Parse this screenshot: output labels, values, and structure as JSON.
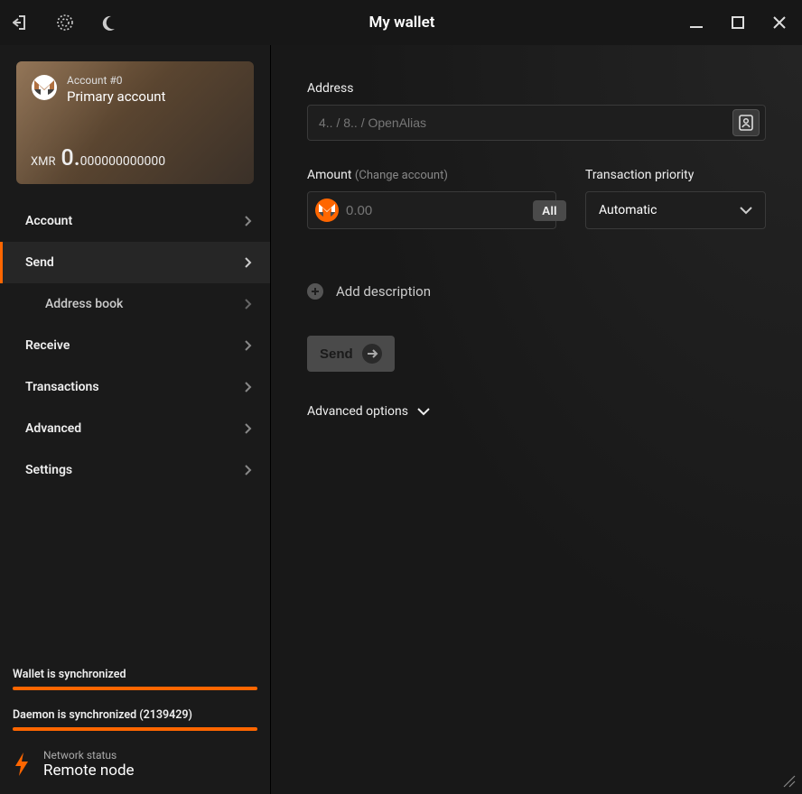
{
  "titlebar": {
    "title": "My wallet"
  },
  "account_card": {
    "account_number": "Account #0",
    "account_name": "Primary account",
    "currency": "XMR",
    "balance_int": "0.",
    "balance_frac": "000000000000"
  },
  "nav": {
    "account": "Account",
    "send": "Send",
    "address_book": "Address book",
    "receive": "Receive",
    "transactions": "Transactions",
    "advanced": "Advanced",
    "settings": "Settings"
  },
  "sync": {
    "wallet": "Wallet is synchronized",
    "daemon": "Daemon is synchronized (2139429)"
  },
  "network": {
    "label": "Network status",
    "value": "Remote node"
  },
  "send_form": {
    "address_label": "Address",
    "address_placeholder": "4.. / 8.. / OpenAlias",
    "amount_label": "Amount",
    "amount_hint": "(Change account)",
    "amount_placeholder": "0.00",
    "all_label": "All",
    "priority_label": "Transaction priority",
    "priority_value": "Automatic",
    "add_description": "Add description",
    "send_button": "Send",
    "advanced_options": "Advanced options"
  }
}
